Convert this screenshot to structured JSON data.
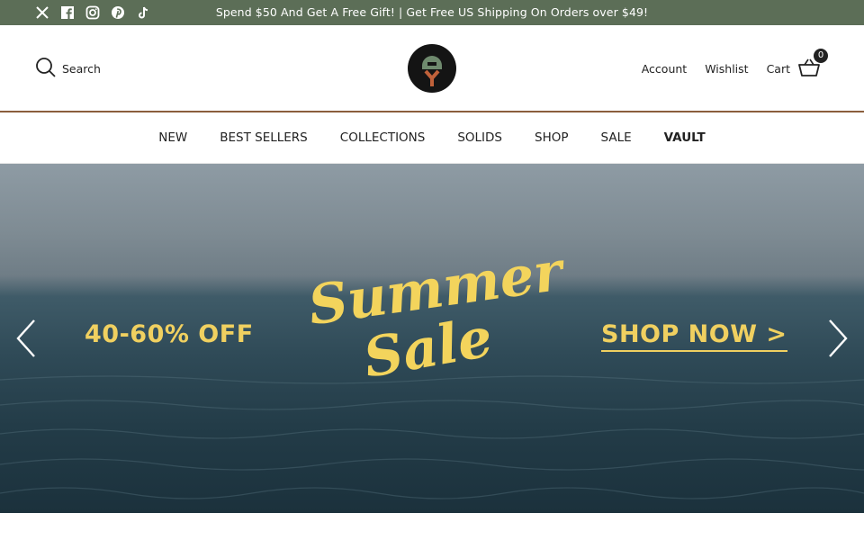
{
  "announcement": {
    "text": "Spend $50 And Get A Free Gift! | Get Free US Shipping On Orders over $49!",
    "social_icons": [
      "x-icon",
      "facebook-icon",
      "instagram-icon",
      "pinterest-icon",
      "tiktok-icon"
    ]
  },
  "header": {
    "search_label": "Search",
    "account_label": "Account",
    "wishlist_label": "Wishlist",
    "cart_label": "Cart",
    "cart_count": "0"
  },
  "nav": {
    "items": [
      "NEW",
      "BEST SELLERS",
      "COLLECTIONS",
      "SOLIDS",
      "SHOP",
      "SALE",
      "VAULT"
    ]
  },
  "hero": {
    "discount": "40-60% OFF",
    "title_line1": "Summer",
    "title_line2": "Sale",
    "cta": "SHOP NOW >"
  },
  "colors": {
    "topbar": "#5c6e57",
    "header_border": "#8b5e3c",
    "promo_yellow": "#f0d060"
  }
}
